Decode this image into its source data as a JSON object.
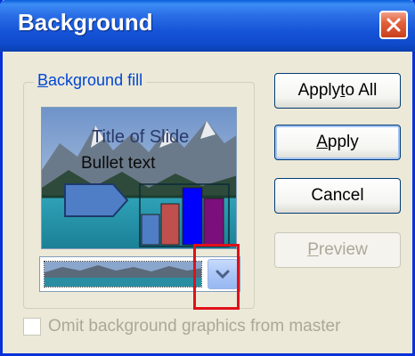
{
  "window": {
    "title": "Background",
    "close_icon": "close-icon"
  },
  "group": {
    "label_accel": "B",
    "label_rest": "ackground fill"
  },
  "preview": {
    "slide_title": "Title of Slide",
    "bullet_text": "Bullet text"
  },
  "combo": {
    "arrow_icon": "chevron-down-icon"
  },
  "buttons": {
    "apply_all_pre": "Apply ",
    "apply_all_accel": "t",
    "apply_all_post": "o All",
    "apply_accel": "A",
    "apply_rest": "pply",
    "cancel": "Cancel",
    "preview_accel": "P",
    "preview_rest": "review"
  },
  "checkbox": {
    "label_pre": "Omit background ",
    "label_accel": "g",
    "label_post": "raphics from master",
    "checked": false
  },
  "colors": {
    "title_bar": "#1654d8",
    "face": "#ece9d8",
    "highlight": "#e0101a",
    "bar1": "#4f7ec6",
    "bar2": "#c0504d",
    "bar3": "#0000ff",
    "bar4": "#7b0f7b"
  }
}
